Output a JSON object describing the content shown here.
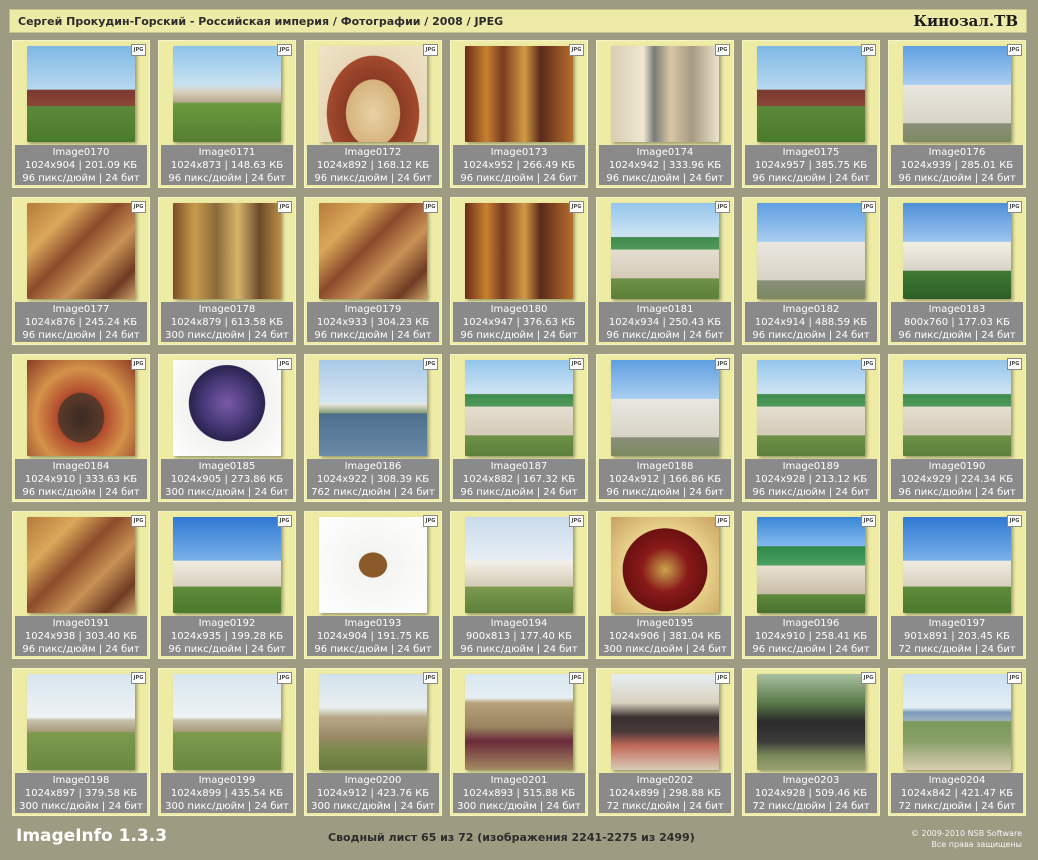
{
  "header": {
    "breadcrumb": "Сергей Прокудин-Горский - Российская империя / Фотографии / 2008 / JPEG",
    "brand": "Кинозал.ТВ"
  },
  "badge_label": "JPG",
  "items": [
    {
      "name": "Image0170",
      "size": "1024x904 | 201.09 КБ",
      "res": "96 пикс/дюйм | 24 бит",
      "thumb": "wooden-church"
    },
    {
      "name": "Image0171",
      "size": "1024x873 | 148.63 КБ",
      "res": "96 пикс/дюйм | 24 бит",
      "thumb": "town-panorama"
    },
    {
      "name": "Image0172",
      "size": "1024x892 | 168.12 КБ",
      "res": "96 пикс/дюйм | 24 бит",
      "thumb": "arched-window"
    },
    {
      "name": "Image0173",
      "size": "1024x952 | 266.49 КБ",
      "res": "96 пикс/дюйм | 24 бит",
      "thumb": "painted-interior"
    },
    {
      "name": "Image0174",
      "size": "1024x942 | 333.96 КБ",
      "res": "96 пикс/дюйм | 24 бит",
      "thumb": "church-gallery"
    },
    {
      "name": "Image0175",
      "size": "1024x957 | 385.75 КБ",
      "res": "96 пикс/дюйм | 24 бит",
      "thumb": "wooden-church"
    },
    {
      "name": "Image0176",
      "size": "1024x939 | 285.01 КБ",
      "res": "96 пикс/дюйм | 24 бит",
      "thumb": "white-church"
    },
    {
      "name": "Image0177",
      "size": "1024x876 | 245.24 КБ",
      "res": "96 пикс/дюйм | 24 бит",
      "thumb": "fresco"
    },
    {
      "name": "Image0178",
      "size": "1024x879 | 613.58 КБ",
      "res": "300 пикс/дюйм | 24 бит",
      "thumb": "iconostasis"
    },
    {
      "name": "Image0179",
      "size": "1024x933 | 304.23 КБ",
      "res": "96 пикс/дюйм | 24 бит",
      "thumb": "fresco"
    },
    {
      "name": "Image0180",
      "size": "1024x947 | 376.63 КБ",
      "res": "96 пикс/дюйм | 24 бит",
      "thumb": "painted-interior"
    },
    {
      "name": "Image0181",
      "size": "1024x934 | 250.43 КБ",
      "res": "96 пикс/дюйм | 24 бит",
      "thumb": "green-roof-church"
    },
    {
      "name": "Image0182",
      "size": "1024x914 | 488.59 КБ",
      "res": "96 пикс/дюйм | 24 бит",
      "thumb": "white-church"
    },
    {
      "name": "Image0183",
      "size": "800x760 | 177.03 КБ",
      "res": "96 пикс/дюйм | 24 бит",
      "thumb": "monastery"
    },
    {
      "name": "Image0184",
      "size": "1024x910 | 333.63 КБ",
      "res": "96 пикс/дюйм | 24 бит",
      "thumb": "ornate-doorway"
    },
    {
      "name": "Image0185",
      "size": "1024x905 | 273.86 КБ",
      "res": "300 пикс/дюйм | 24 бит",
      "thumb": "mitre"
    },
    {
      "name": "Image0186",
      "size": "1024x922 | 308.39 КБ",
      "res": "762 пикс/дюйм | 24 бит",
      "thumb": "river-view"
    },
    {
      "name": "Image0187",
      "size": "1024x882 | 167.32 КБ",
      "res": "96 пикс/дюйм | 24 бит",
      "thumb": "green-roof-church"
    },
    {
      "name": "Image0188",
      "size": "1024x912 | 166.86 КБ",
      "res": "96 пикс/дюйм | 24 бит",
      "thumb": "white-church"
    },
    {
      "name": "Image0189",
      "size": "1024x928 | 213.12 КБ",
      "res": "96 пикс/дюйм | 24 бит",
      "thumb": "green-roof-church"
    },
    {
      "name": "Image0190",
      "size": "1024x929 | 224.34 КБ",
      "res": "96 пикс/дюйм | 24 бит",
      "thumb": "green-roof-church"
    },
    {
      "name": "Image0191",
      "size": "1024x938 | 303.40 КБ",
      "res": "96 пикс/дюйм | 24 бит",
      "thumb": "fresco"
    },
    {
      "name": "Image0192",
      "size": "1024x935 | 199.28 КБ",
      "res": "96 пикс/дюйм | 24 бит",
      "thumb": "church-sky"
    },
    {
      "name": "Image0193",
      "size": "1024x904 | 191.75 КБ",
      "res": "96 пикс/дюйм | 24 бит",
      "thumb": "cross"
    },
    {
      "name": "Image0194",
      "size": "900x813 | 177.40 КБ",
      "res": "96 пикс/дюйм | 24 бит",
      "thumb": "river-church"
    },
    {
      "name": "Image0195",
      "size": "1024x906 | 381.04 КБ",
      "res": "300 пикс/дюйм | 24 бит",
      "thumb": "chalices"
    },
    {
      "name": "Image0196",
      "size": "1024x910 | 258.41 КБ",
      "res": "96 пикс/дюйм | 24 бит",
      "thumb": "green-dome-church"
    },
    {
      "name": "Image0197",
      "size": "901x891 | 203.45 КБ",
      "res": "72 пикс/дюйм | 24 бит",
      "thumb": "church-sky"
    },
    {
      "name": "Image0198",
      "size": "1024x897 | 379.58 КБ",
      "res": "300 пикс/дюйм | 24 бит",
      "thumb": "field-buildings"
    },
    {
      "name": "Image0199",
      "size": "1024x899 | 435.54 КБ",
      "res": "300 пикс/дюйм | 24 бит",
      "thumb": "field-buildings"
    },
    {
      "name": "Image0200",
      "size": "1024x912 | 423.76 КБ",
      "res": "300 пикс/дюйм | 24 бит",
      "thumb": "construction"
    },
    {
      "name": "Image0201",
      "size": "1024x893 | 515.88 КБ",
      "res": "300 пикс/дюйм | 24 бит",
      "thumb": "people-hill"
    },
    {
      "name": "Image0202",
      "size": "1024x899 | 298.88 КБ",
      "res": "72 пикс/дюйм | 24 бит",
      "thumb": "people-group"
    },
    {
      "name": "Image0203",
      "size": "1024x928 | 509.46 КБ",
      "res": "72 пикс/дюйм | 24 бит",
      "thumb": "people-forest"
    },
    {
      "name": "Image0204",
      "size": "1024x842 | 421.47 КБ",
      "res": "72 пикс/дюйм | 24 бит",
      "thumb": "coast-town"
    }
  ],
  "thumb_styles": {
    "wooden-church": "linear-gradient(180deg,#7fb8e6 0%,#b7d8ef 45%,#7a3b30 46%,#8a4536 62%,#5c8a3a 63%,#4b7a2b 100%)",
    "town-panorama": "linear-gradient(180deg,#8ec3ea 0%,#c9e2f2 40%,#d8d0c0 48%,#b9a98e 58%,#6a9a3e 60%,#567f32 100%)",
    "arched-window": "radial-gradient(ellipse at 50% 70%,#e8d2a5 0%,#d6b37d 35%,#8b3b24 36%,#a24a2e 60%,#e7d8b8 61%,#f0e4c7 100%)",
    "painted-interior": "linear-gradient(90deg,#6b2c1a 0%,#c8812f 20%,#7a3a20 35%,#d39a45 55%,#5a2a1a 70%,#b86e2c 100%)",
    "church-gallery": "linear-gradient(90deg,#d9cdb3 0%,#efe7d2 30%,#7a7b78 40%,#d8c7a6 55%,#a79a82 75%,#ece3cc 100%)",
    "white-church": "linear-gradient(180deg,#5f9fe0 0%,#a9cdf1 40%,#e9e7df 41%,#d8d4c8 80%,#8a8f7a 81%,#7c8a60 100%)",
    "fresco": "linear-gradient(135deg,#b77a3a 0%,#d9a85a 25%,#8c4a2a 45%,#c99255 65%,#6e3a22 85%,#caa068 100%)",
    "iconostasis": "linear-gradient(90deg,#7a4f25 0%,#c99a4c 20%,#8a6a3a 40%,#d8b46a 60%,#6b4a28 80%,#bb8d48 100%)",
    "green-roof-church": "linear-gradient(180deg,#94c6ec 0%,#cfe4f3 35%,#3f8a4e 36%,#4f9a5a 48%,#e4ddd0 49%,#d6cbb8 78%,#6e9148 79%,#5c7f3a 100%)",
    "monastery": "linear-gradient(180deg,#4f8fd8 0%,#9cc6ee 40%,#f1eee4 41%,#d9d5c8 70%,#3f7a34 71%,#2e5f27 100%)",
    "ornate-doorway": "radial-gradient(ellipse at 50% 60%,#3a2a22 0%,#5a3a2a 30%,#b24a2c 31%,#d4924a 60%,#8a3a24 100%)",
    "mitre": "radial-gradient(circle at 50% 45%,#7a5aa8 0%,#4a3a7a 30%,#2a2350 50%,#f2f2f0 51%,#ffffff 100%)",
    "river-view": "linear-gradient(180deg,#a9c9e6 0%,#d6e6f2 45%,#e9e6da 46%,#8aa07a 55%,#4d6f8e 56%,#6a8aa6 100%)",
    "church-sky": "linear-gradient(180deg,#2f78d2 0%,#79b1ea 45%,#f0ece2 46%,#d9d0bf 72%,#5e8c3a 73%,#4c7a2e 100%)",
    "cross": "radial-gradient(ellipse at 50% 50%,#8a5a2a 0%,#8a5a2a 18%,#f4f4f2 19%,#ffffff 100%)",
    "river-church": "linear-gradient(180deg,#c9dbeb 0%,#e7eef4 45%,#f4f1e8 46%,#d3cbb6 72%,#7a9a50 73%,#5e7f38 100%)",
    "chalices": "radial-gradient(ellipse at 50% 55%,#c9a54a 0%,#8a1a1a 30%,#6a1010 55%,#e7d08a 56%,#c8a060 100%)",
    "green-dome-church": "linear-gradient(180deg,#3a86d6 0%,#84baee 30%,#2f8a4a 31%,#4aa060 50%,#e8e0d0 51%,#c9bea8 80%,#5f8a3a 81%,#4a7030 100%)",
    "field-buildings": "linear-gradient(180deg,#d8e6ef 0%,#eef3f4 45%,#c9c2b0 48%,#a89a7a 60%,#7d9a4e 61%,#6a8840 100%)",
    "construction": "linear-gradient(180deg,#d2e2ec 0%,#e9eff0 35%,#b8a989 45%,#9a8a66 65%,#7a8a4a 80%,#6a7a40 100%)",
    "people-hill": "linear-gradient(180deg,#d8e8f0 0%,#e6eef2 25%,#b8a27a 30%,#9a8460 55%,#6a2a3a 70%,#a48a62 100%)",
    "people-group": "linear-gradient(180deg,#e7eef3 0%,#d9d2c0 30%,#3a3030 45%,#4a3a3a 60%,#c26a5a 75%,#d8cdb8 100%)",
    "people-forest": "linear-gradient(180deg,#a8c0a0 0%,#5a7a4a 30%,#2a2a2a 50%,#3a3a3a 70%,#7a8a5a 85%,#9aa070 100%)",
    "coast-town": "linear-gradient(180deg,#c9dff0 0%,#e4eef5 35%,#7a9ab8 40%,#9bb0c0 48%,#7a9a5a 50%,#8aa06a 70%,#d8cdb0 100%)"
  },
  "footer": {
    "app_name": "ImageInfo 1.3.3",
    "summary": "Сводный лист 65 из 72 (изображения 2241-2275 из 2499)",
    "copyright": "© 2009-2010 NSB Software",
    "rights": "Все права защищены"
  }
}
